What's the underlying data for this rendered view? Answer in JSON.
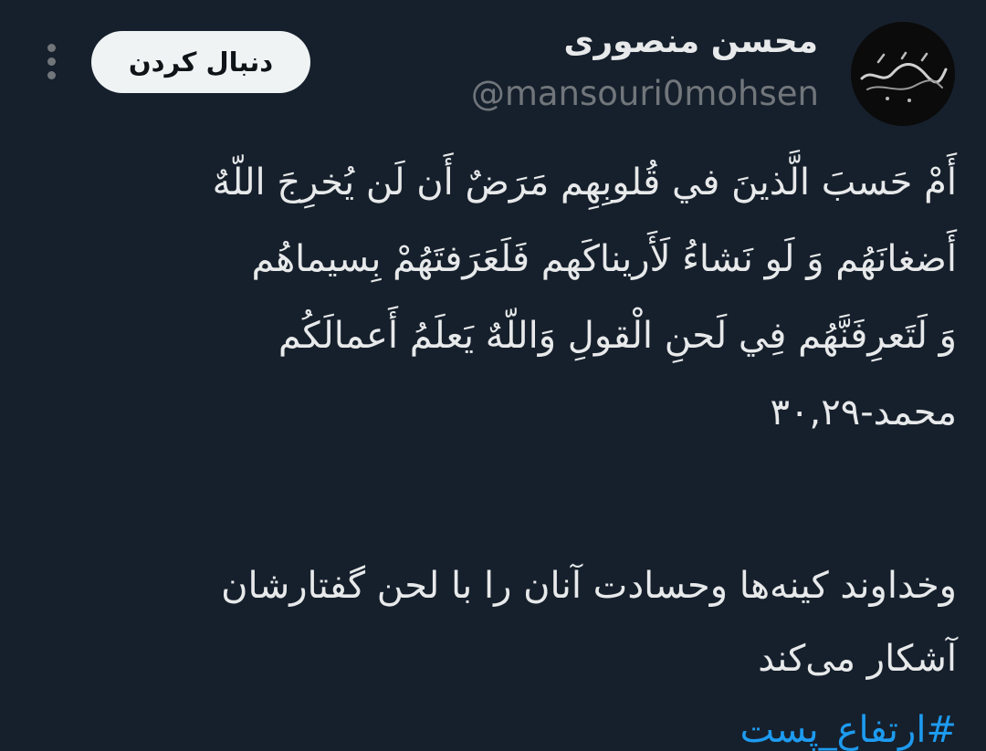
{
  "author": {
    "display_name": "محسن منصوری",
    "handle": "@mansouri0mohsen",
    "avatar_logo_text": "محسن منصوری"
  },
  "actions": {
    "follow_label": "دنبال کردن",
    "more_icon": "more-vertical-icon"
  },
  "tweet": {
    "verse_lines": [
      "أَمْ حَسبَ الَّذينَ في قُلوبِهِم مَرَضٌ أَن لَن يُخرِجَ اللّهٌ",
      "أَضغانَهُم وَ لَو نَشاءُ لَأَريناكَهم فَلَعَرَفتَهُمْ بِسيماهُم",
      "وَ لَتَعرِفَنَّهُم فِي لَحنِ الْقولِ وَاللّهٌ يَعلَمُ أَعمالَكُم",
      "محمد-۳۰,۲۹"
    ],
    "translation_lines": [
      "وخداوند کینه‌ها وحسادت آنان را با لحن گفتارشان",
      "آشکار می‌کند"
    ],
    "hashtag": "#ارتفاع_پست"
  },
  "colors": {
    "background": "#16202c",
    "text": "#e7e9ea",
    "secondary_text": "#71767b",
    "link": "#1d9bf0",
    "follow_button_bg": "#eff3f4"
  }
}
